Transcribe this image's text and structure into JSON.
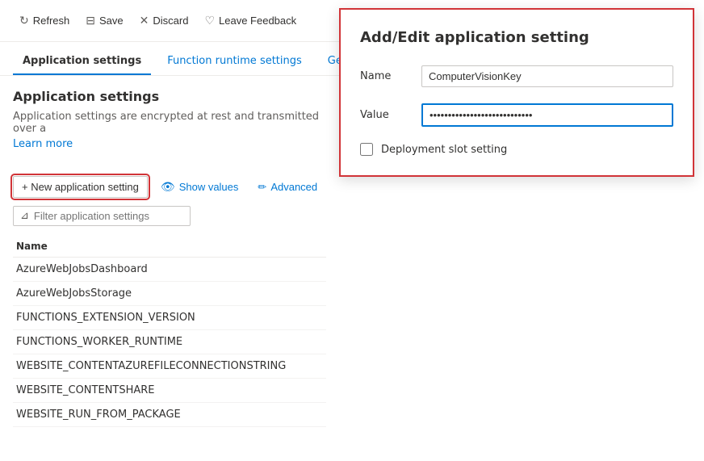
{
  "toolbar": {
    "refresh_label": "Refresh",
    "save_label": "Save",
    "discard_label": "Discard",
    "feedback_label": "Leave Feedback"
  },
  "tabs": {
    "items": [
      {
        "id": "app-settings",
        "label": "Application settings",
        "active": true
      },
      {
        "id": "function-runtime",
        "label": "Function runtime settings",
        "active": false
      },
      {
        "id": "general",
        "label": "General",
        "active": false
      }
    ]
  },
  "page": {
    "section_title": "Application settings",
    "description": "Application settings are encrypted at rest and transmitted over a",
    "learn_more": "Learn more"
  },
  "actions": {
    "new_label": "+ New application setting",
    "show_values_label": "Show values",
    "advanced_label": "Advanced"
  },
  "filter": {
    "placeholder": "Filter application settings"
  },
  "table": {
    "column_name": "Name",
    "rows": [
      {
        "name": "AzureWebJobsDashboard"
      },
      {
        "name": "AzureWebJobsStorage"
      },
      {
        "name": "FUNCTIONS_EXTENSION_VERSION"
      },
      {
        "name": "FUNCTIONS_WORKER_RUNTIME"
      },
      {
        "name": "WEBSITE_CONTENTAZUREFILECONNECTIONSTRING"
      },
      {
        "name": "WEBSITE_CONTENTSHARE"
      },
      {
        "name": "WEBSITE_RUN_FROM_PACKAGE"
      }
    ]
  },
  "dialog": {
    "title": "Add/Edit application setting",
    "name_label": "Name",
    "name_value": "ComputerVisionKey",
    "value_label": "Value",
    "value_placeholder": "****************************",
    "checkbox_label": "Deployment slot setting"
  }
}
